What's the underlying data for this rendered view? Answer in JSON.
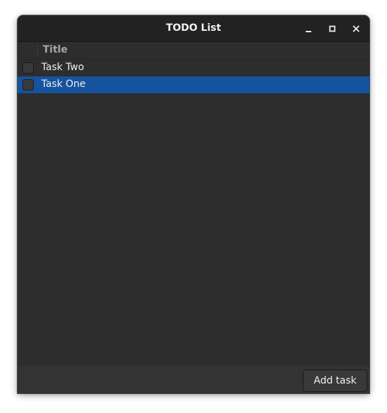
{
  "window": {
    "title": "TODO List",
    "controls": {
      "minimize": "minimize-icon",
      "maximize": "maximize-icon",
      "close": "close-icon"
    }
  },
  "list": {
    "column_header": "Title",
    "rows": [
      {
        "label": "Task Two",
        "checked": false,
        "selected": false
      },
      {
        "label": "Task One",
        "checked": false,
        "selected": true
      }
    ]
  },
  "footer": {
    "add_label": "Add task"
  },
  "colors": {
    "background": "#2d2d2d",
    "titlebar": "#222222",
    "selection": "#15539e",
    "text": "#eeeeee"
  }
}
